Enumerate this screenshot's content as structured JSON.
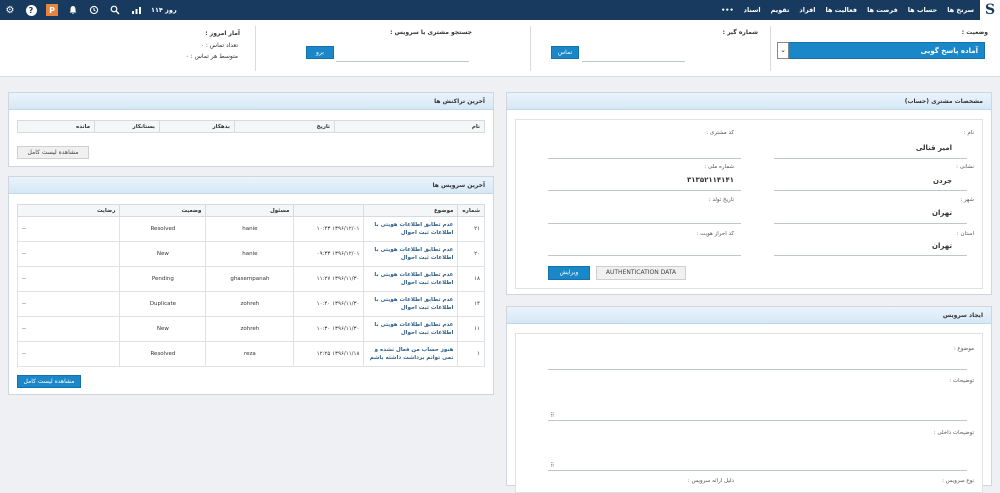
{
  "topbar": {
    "logo": "S",
    "nav": [
      "سرنخ ها",
      "حساب ها",
      "فرصت ها",
      "فعالیت ها",
      "افراد",
      "تقویم",
      "اسناد",
      "•••"
    ],
    "days": "۱۱۴ روز",
    "p_badge": "P"
  },
  "status": {
    "state_label": "وضعیت :",
    "state_value": "آماده پاسخ گویی",
    "dial_label": "شماره گیر :",
    "call_button": "تماس",
    "search_label": "جستجو مشتری یا سرویس :",
    "go_button": "برو",
    "stats_title": "آمار امروز :",
    "stats_count": "تعداد تماس : ۰",
    "stats_avg": "متوسط هر تماس : ۰"
  },
  "customer": {
    "title": "مشخصات مشتری (حساب)",
    "name_label": "نام :",
    "name_value": "امیر قنالی",
    "code_label": "کد مشتری :",
    "address_label": "نشانی :",
    "address_value": "جردن",
    "national_label": "شماره ملی :",
    "national_value": "۳۱۳۵۲۱۱۴۱۴۱",
    "city_label": "شهر :",
    "city_value": "تهران",
    "birth_label": "تاریخ تولد :",
    "province_label": "استان :",
    "province_value": "تهران",
    "auth_code_label": "کد احراز هویت :",
    "edit_button": "ویرایش",
    "auth_button": "AUTHENTICATION DATA"
  },
  "create_service": {
    "title": "ایجاد سرویس",
    "subject_label": "موضوع :",
    "desc_label": "توضیحات :",
    "internal_desc_label": "توضیحات داخلی :",
    "type_label": "نوع سرویس :",
    "reason_label": "دلیل ارائه سرویس :"
  },
  "transactions": {
    "title": "آخرین تراکنش ها",
    "headers": [
      "نام",
      "تاریخ",
      "بدهکار",
      "بستانکار",
      "مانده"
    ],
    "full_list_button": "مشاهده لیست کامل"
  },
  "services": {
    "title": "آخرین سرویس ها",
    "headers": [
      "شماره",
      "موضوع",
      "",
      "مسئول",
      "وضعیت",
      "رضایت"
    ],
    "rows": [
      {
        "num": "۲۱",
        "subject": "عدم تطابق اطلاعات هویتی با اطلاعات ثبت احوال",
        "date": "۱۳۹۶/۱۲/۰۱ ۱۰:۴۳",
        "owner": "hanie",
        "status": "Resolved",
        "satisfaction": "--"
      },
      {
        "num": "۲۰",
        "subject": "عدم تطابق اطلاعات هویتی با اطلاعات ثبت احوال",
        "date": "۱۳۹۶/۱۲/۰۱ ۰۹:۳۳",
        "owner": "hanie",
        "status": "New",
        "satisfaction": "--"
      },
      {
        "num": "۱۸",
        "subject": "عدم تطابق اطلاعات هویتی با اطلاعات ثبت احوال",
        "date": "۱۳۹۶/۱۱/۳۰ ۱۱:۲۷",
        "owner": "ghasempanah",
        "status": "Pending",
        "satisfaction": "--"
      },
      {
        "num": "۱۴",
        "subject": "عدم تطابق اطلاعات هویتی با اطلاعات ثبت احوال",
        "date": "۱۳۹۶/۱۱/۳۰ ۱۰:۴۰",
        "owner": "zohreh",
        "status": "Duplicate",
        "satisfaction": "--"
      },
      {
        "num": "۱۱",
        "subject": "عدم تطابق اطلاعات هویتی با اطلاعات ثبت احوال",
        "date": "۱۳۹۶/۱۱/۳۰ ۱۰:۳۰",
        "owner": "zohreh",
        "status": "New",
        "satisfaction": "--"
      },
      {
        "num": "۱",
        "subject": "هنوز حساب من فعال نشده و نمی توانم برداشت داشته باشم",
        "date": "۱۳۹۶/۱۱/۱۸ ۱۲:۲۵",
        "owner": "reza",
        "status": "Resolved",
        "satisfaction": "--"
      }
    ],
    "full_list_button": "مشاهده لیست کامل"
  }
}
